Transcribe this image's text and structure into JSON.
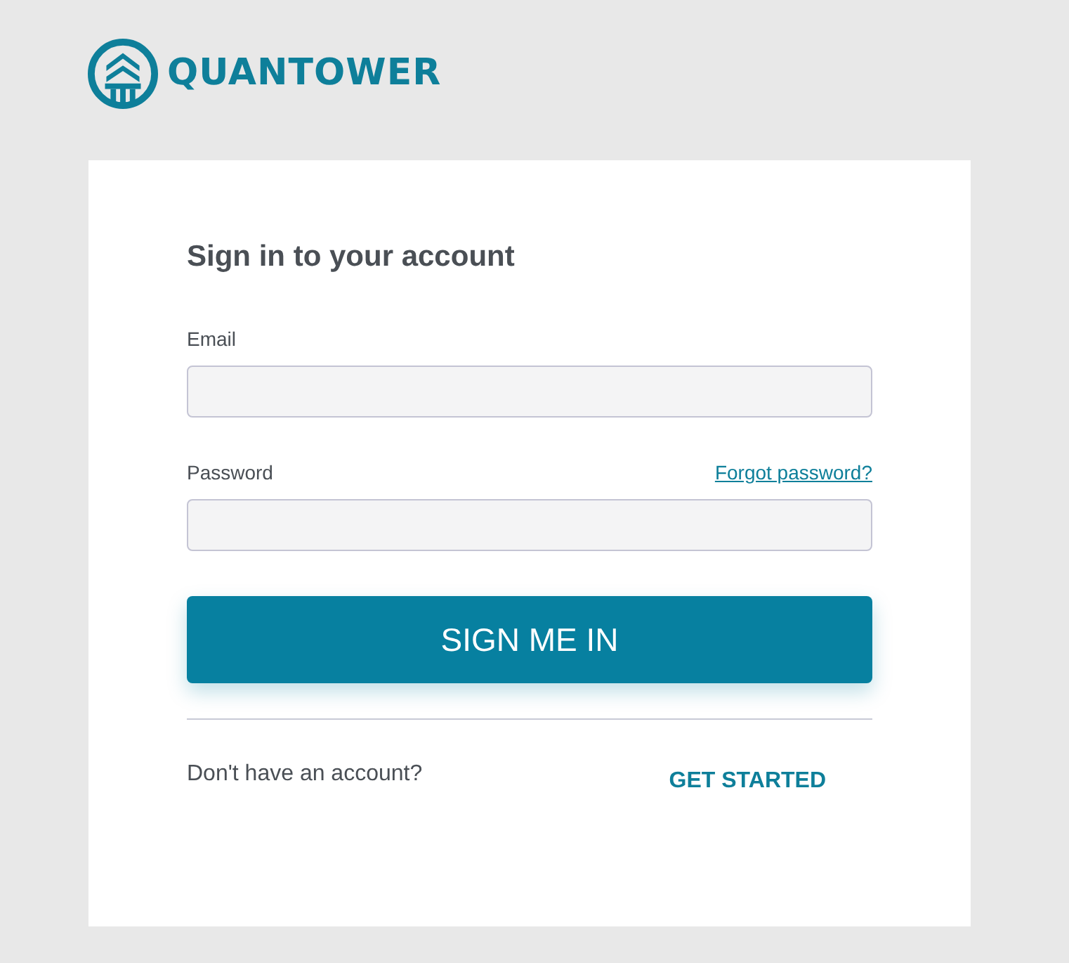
{
  "brand": {
    "name": "QUANTOWER"
  },
  "form": {
    "title": "Sign in to your account",
    "fields": [
      {
        "label": "Email"
      },
      {
        "label": "Password",
        "link": "Forgot password?"
      }
    ],
    "submit": "SIGN ME IN",
    "signup_prompt": "Don't have an account?",
    "signup_link": "GET STARTED"
  }
}
